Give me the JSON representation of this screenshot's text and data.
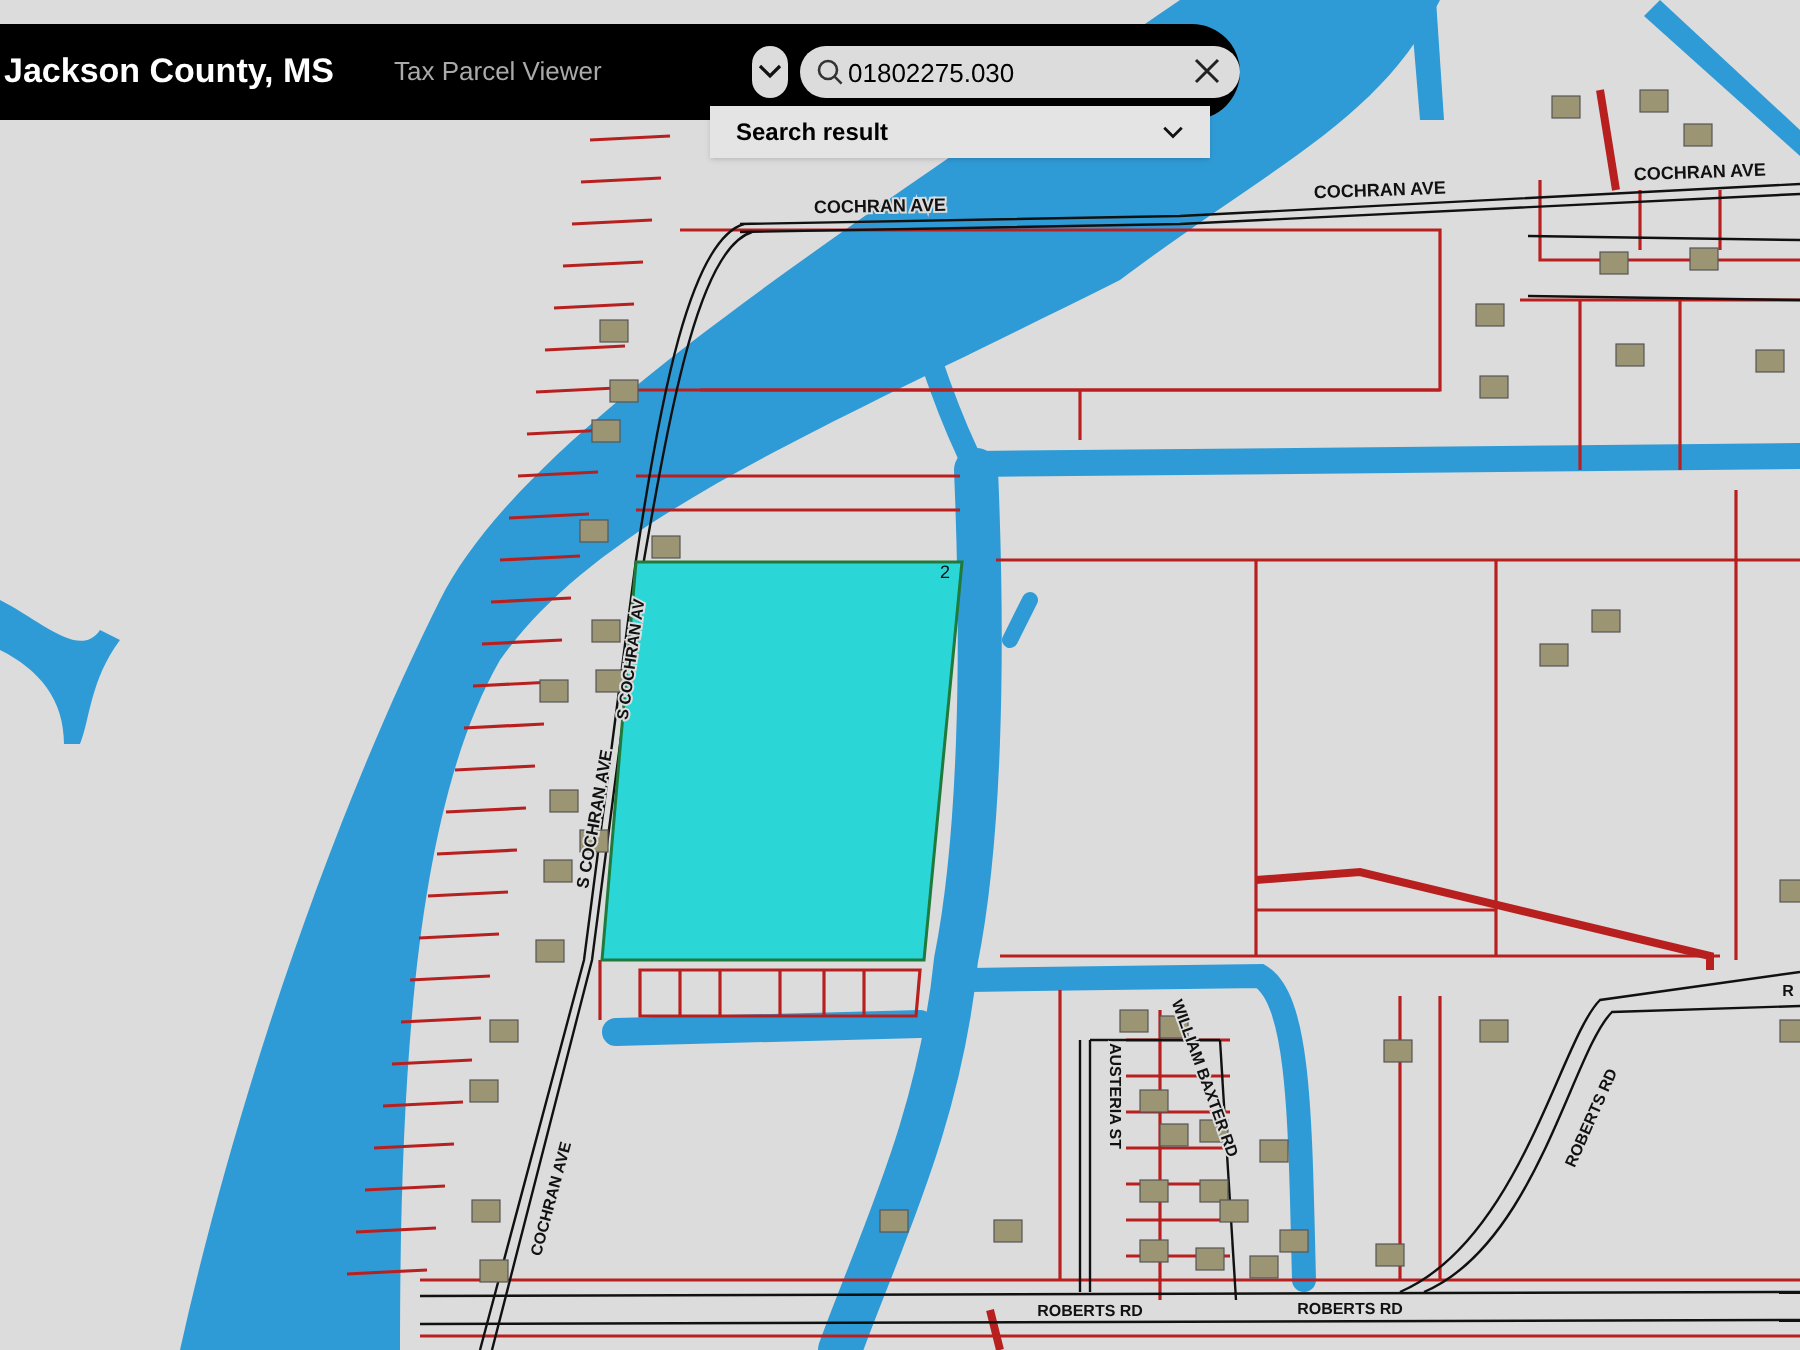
{
  "header": {
    "title": "Jackson County, MS",
    "subtitle": "Tax Parcel Viewer"
  },
  "search": {
    "value": "01802275.030",
    "results_label": "Search result"
  },
  "map": {
    "parcel_label": "2",
    "street_labels": [
      {
        "text": "COCHRAN AVE"
      },
      {
        "text": "COCHRAN AVE"
      },
      {
        "text": "COCHRAN AVE"
      },
      {
        "text": "S COCHRAN AVE"
      },
      {
        "text": "S COCHRAN AV"
      },
      {
        "text": "COCHRAN AVE"
      },
      {
        "text": "WILLIAM BAXTER RD"
      },
      {
        "text": "AUSTERIA ST"
      },
      {
        "text": "ROBERTS RD"
      },
      {
        "text": "ROBERTS RD"
      },
      {
        "text": "ROBERTS RD"
      },
      {
        "text": "R"
      }
    ]
  }
}
